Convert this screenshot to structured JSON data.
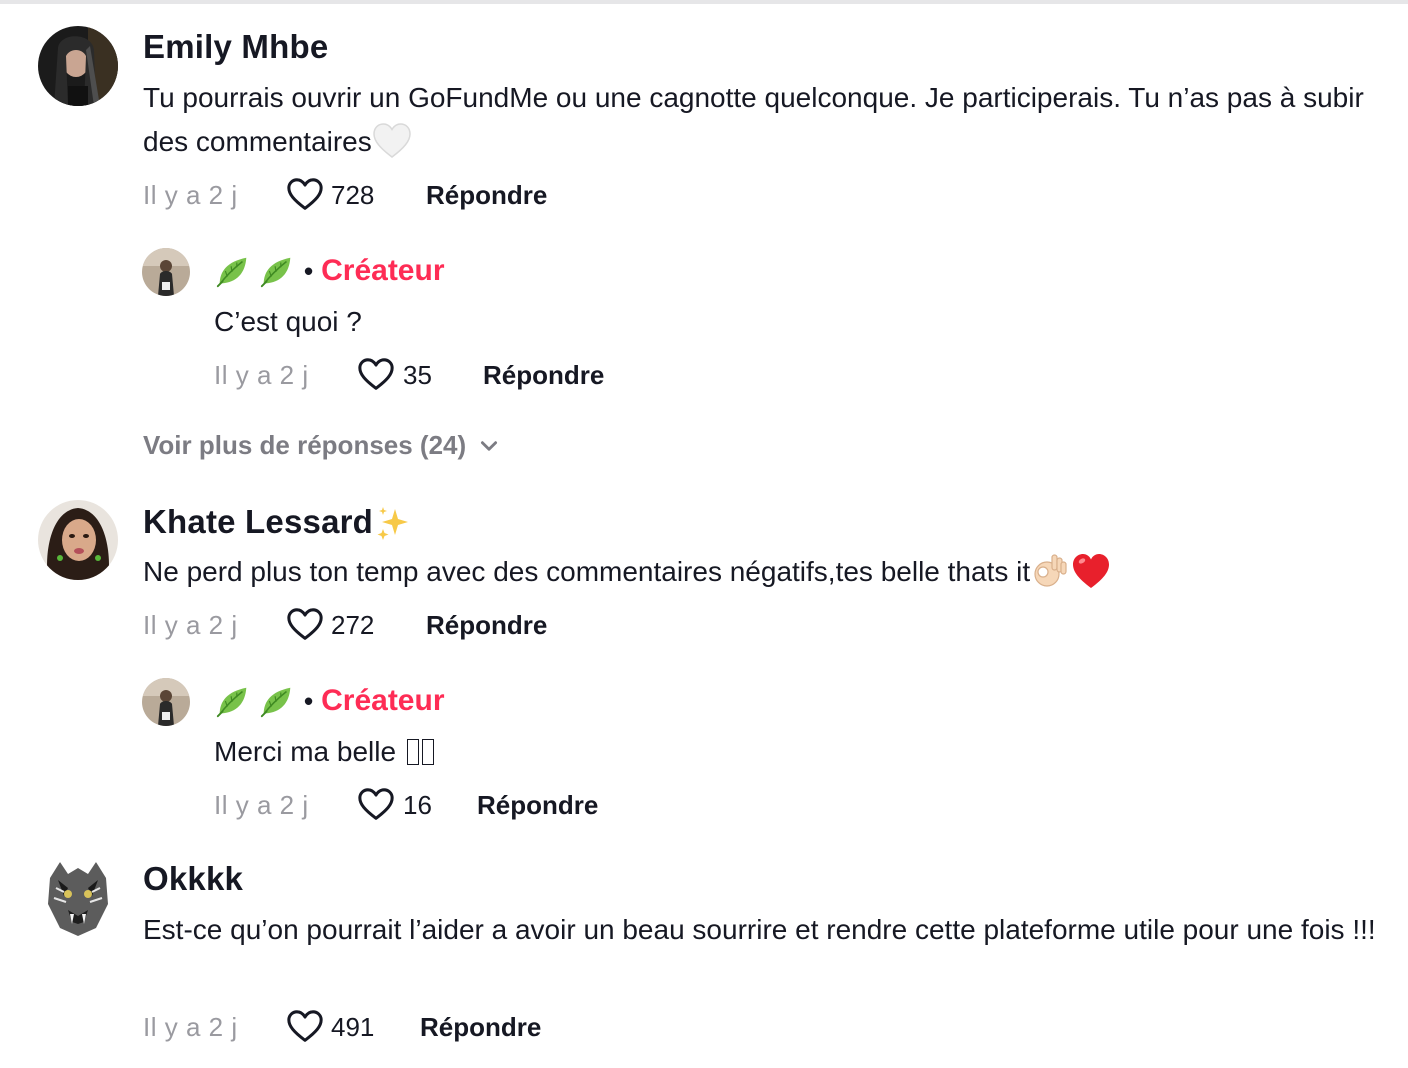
{
  "comments": [
    {
      "username": "Emily Mhbe",
      "text": "Tu pourrais ouvrir un GoFundMe ou une cagnotte quelconque. Je participerais. Tu n’as pas à subir des commentaires",
      "text_emoji": "white-heart",
      "time": "Il y a 2 j",
      "likes": "728",
      "reply_label": "Répondre",
      "replies": [
        {
          "username_icons": [
            "leaf-icon",
            "leaf-icon"
          ],
          "badge": "Créateur",
          "text": "C’est quoi ?",
          "time": "Il y a 2 j",
          "likes": "35",
          "reply_label": "Répondre"
        }
      ],
      "more_replies_label": "Voir plus de réponses (24)"
    },
    {
      "username": "Khate Lessard",
      "username_emoji": "sparkles",
      "text": "Ne perd plus ton temp avec des commentaires négatifs,tes belle thats it",
      "text_emojis": [
        "ok-hand",
        "red-heart"
      ],
      "time": "Il y a 2 j",
      "likes": "272",
      "reply_label": "Répondre",
      "replies": [
        {
          "username_icons": [
            "leaf-icon",
            "leaf-icon"
          ],
          "badge": "Créateur",
          "text": "Merci ma belle",
          "time": "Il y a 2 j",
          "likes": "16",
          "reply_label": "Répondre"
        }
      ]
    },
    {
      "username": "Okkkk",
      "text": "Est-ce qu’on pourrait l’aider a avoir un beau sourrire et rendre cette plateforme utile pour une fois !!!",
      "time": "Il y a 2 j",
      "likes": "491",
      "reply_label": "Répondre"
    }
  ],
  "colors": {
    "creator_badge": "#fe2c55",
    "muted": "#9a9aa0",
    "text": "#161823"
  }
}
